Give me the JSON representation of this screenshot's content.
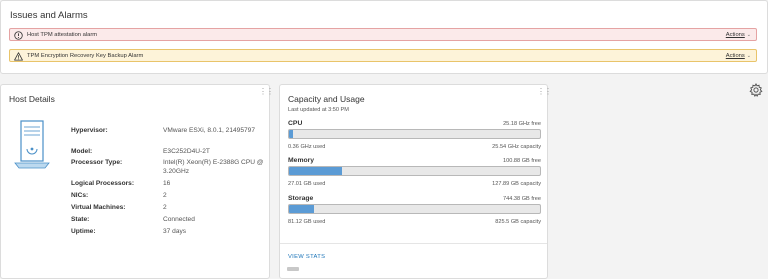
{
  "issues": {
    "title": "Issues and Alarms",
    "alarms": [
      {
        "text": "Host TPM attestation alarm",
        "action": "Actions",
        "severity": "error",
        "color": "#c92100"
      },
      {
        "text": "TPM Encryption Recovery Key Backup Alarm",
        "action": "Actions",
        "severity": "warning",
        "color": "#c27b00"
      }
    ]
  },
  "host": {
    "title": "Host Details",
    "fields": [
      {
        "key": "Hypervisor:",
        "value": "VMware ESXi, 8.0.1, 21495797"
      },
      {
        "key": "Model:",
        "value": "E3C252D4U-2T"
      },
      {
        "key": "Processor Type:",
        "value": "Intel(R) Xeon(R) E-2388G CPU @ 3.20GHz"
      },
      {
        "key": "Logical Processors:",
        "value": "16"
      },
      {
        "key": "NICs:",
        "value": "2"
      },
      {
        "key": "Virtual Machines:",
        "value": "2"
      },
      {
        "key": "State:",
        "value": "Connected"
      },
      {
        "key": "Uptime:",
        "value": "37 days"
      }
    ]
  },
  "capacity": {
    "title": "Capacity and Usage",
    "updated": "Last updated at 3:50 PM",
    "resources": [
      {
        "name": "CPU",
        "free": "25.18 GHz free",
        "used": "0.36 GHz used",
        "capacity": "25.54 GHz capacity",
        "fraction": 0.014
      },
      {
        "name": "Memory",
        "free": "100.88 GB free",
        "used": "27.01 GB used",
        "capacity": "127.89 GB capacity",
        "fraction": 0.211
      },
      {
        "name": "Storage",
        "free": "744.38 GB free",
        "used": "81.12 GB used",
        "capacity": "825.5 GB capacity",
        "fraction": 0.098
      }
    ],
    "view_stats": "VIEW STATS",
    "bar_color": "#5b9bd5"
  },
  "icons": {
    "server": "server-icon",
    "settings": "gear-icon"
  }
}
